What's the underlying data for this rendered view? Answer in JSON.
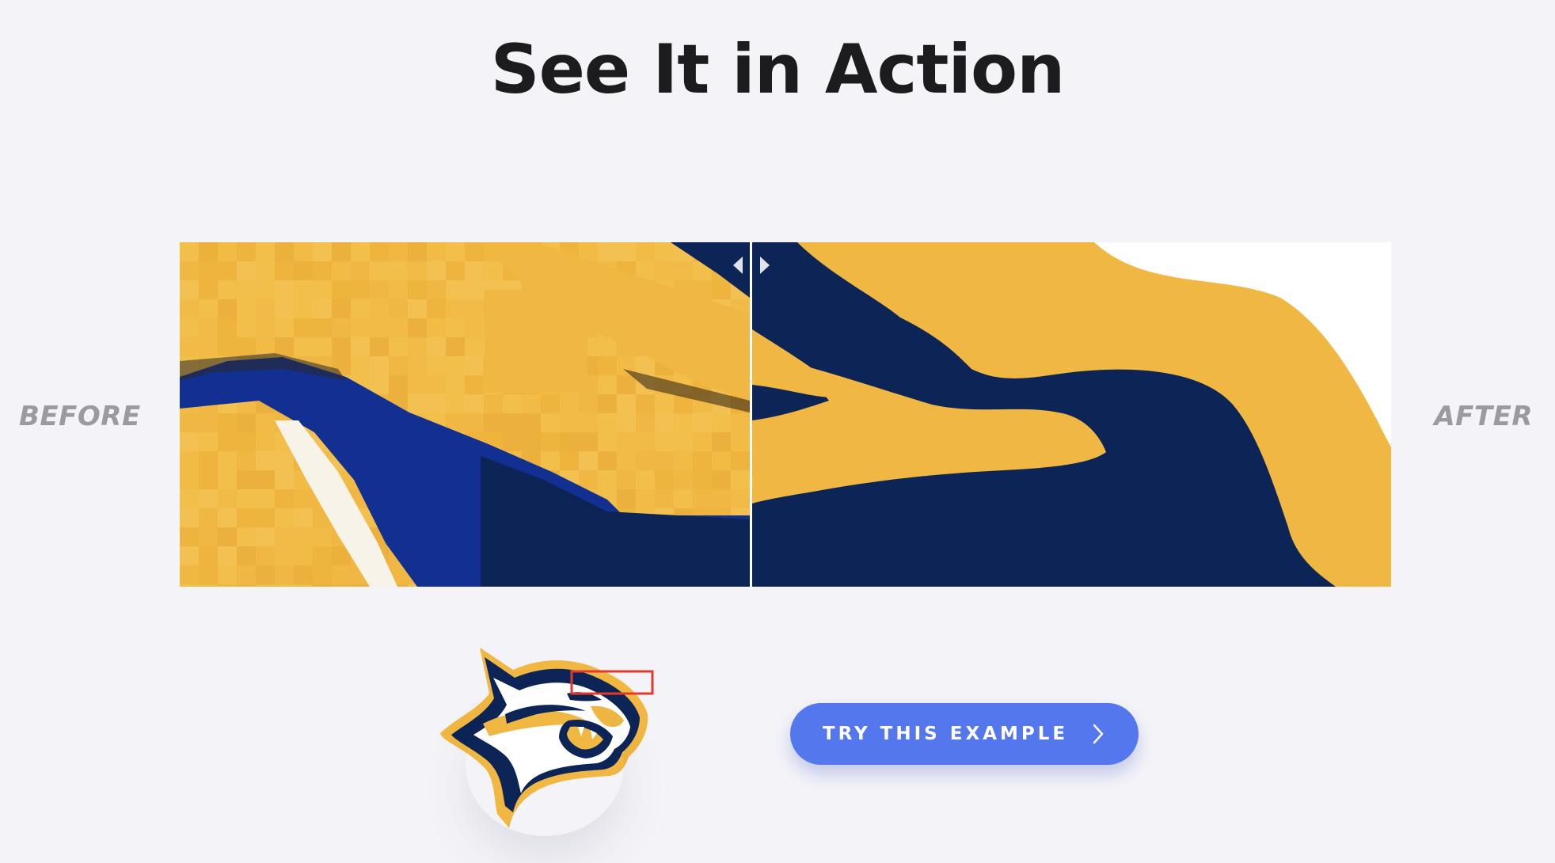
{
  "page": {
    "title": "See It in Action"
  },
  "comparison": {
    "before_label": "BEFORE",
    "after_label": "AFTER"
  },
  "cta": {
    "label": "TRY THIS EXAMPLE",
    "icon": "chevron-right-icon"
  },
  "colors": {
    "background": "#f4f4f8",
    "gold": "#f0b842",
    "navy": "#0c2556",
    "button": "#5577ee",
    "highlight_box": "#e03a2e"
  }
}
